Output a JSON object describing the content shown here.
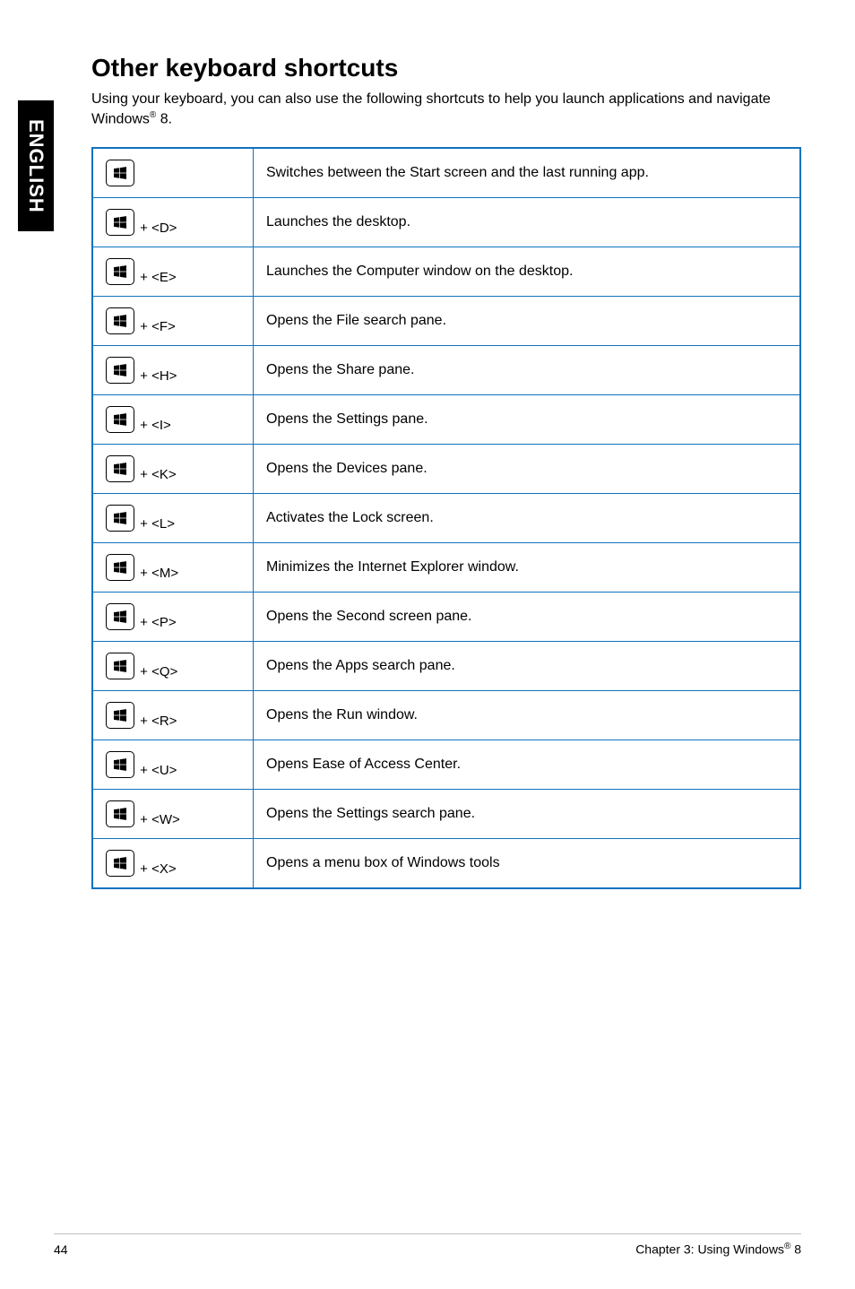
{
  "side_tab": "ENGLISH",
  "title": "Other keyboard shortcuts",
  "intro_a": "Using your keyboard, you can also use the following shortcuts to help you launch applications and navigate Windows",
  "intro_b": " 8.",
  "reg": "®",
  "shortcuts": [
    {
      "suffix": "",
      "desc": "Switches between the Start screen and the last running app."
    },
    {
      "suffix": " + <D>",
      "desc": "Launches the desktop."
    },
    {
      "suffix": " + <E>",
      "desc": "Launches the Computer window on the desktop."
    },
    {
      "suffix": " + <F>",
      "desc": "Opens the File search pane."
    },
    {
      "suffix": " + <H>",
      "desc": "Opens the Share pane."
    },
    {
      "suffix": " + <I>",
      "desc": "Opens the Settings pane."
    },
    {
      "suffix": " + <K>",
      "desc": "Opens the Devices pane."
    },
    {
      "suffix": " + <L>",
      "desc": "Activates the Lock screen."
    },
    {
      "suffix": " + <M>",
      "desc": "Minimizes the Internet Explorer window."
    },
    {
      "suffix": " + <P>",
      "desc": "Opens the Second screen pane."
    },
    {
      "suffix": " + <Q>",
      "desc": "Opens the Apps search pane."
    },
    {
      "suffix": " + <R>",
      "desc": "Opens the Run window."
    },
    {
      "suffix": " + <U>",
      "desc": "Opens Ease of Access Center."
    },
    {
      "suffix": " + <W>",
      "desc": "Opens the Settings search pane."
    },
    {
      "suffix": " + <X>",
      "desc": "Opens a menu box of Windows tools"
    }
  ],
  "footer": {
    "page_no": "44",
    "chapter_a": "Chapter 3: Using Windows",
    "chapter_b": " 8"
  }
}
